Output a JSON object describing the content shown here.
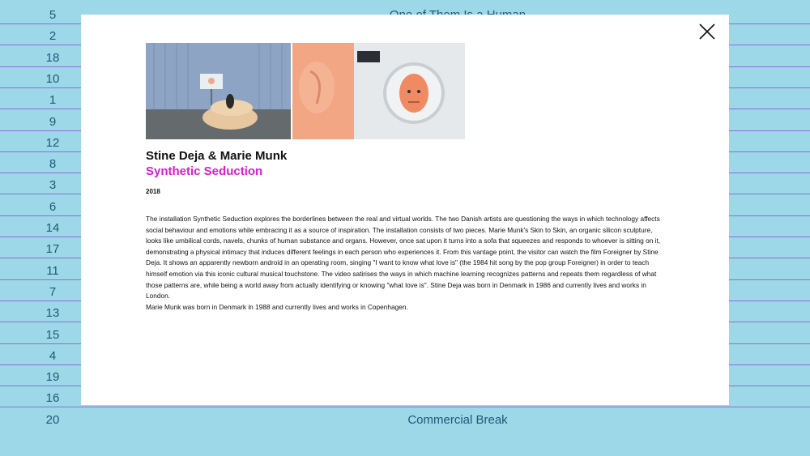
{
  "background_list": {
    "rows": [
      {
        "number": "5",
        "title": "One of Them Is a Human"
      },
      {
        "number": "2",
        "title": ""
      },
      {
        "number": "18",
        "title": ""
      },
      {
        "number": "10",
        "title": ""
      },
      {
        "number": "1",
        "title": ""
      },
      {
        "number": "9",
        "title": ""
      },
      {
        "number": "12",
        "title": ""
      },
      {
        "number": "8",
        "title": ""
      },
      {
        "number": "3",
        "title": ""
      },
      {
        "number": "6",
        "title": ""
      },
      {
        "number": "14",
        "title": ""
      },
      {
        "number": "17",
        "title": ""
      },
      {
        "number": "11",
        "title": ""
      },
      {
        "number": "7",
        "title": ""
      },
      {
        "number": "13",
        "title": ""
      },
      {
        "number": "15",
        "title": ""
      },
      {
        "number": "4",
        "title": ""
      },
      {
        "number": "19",
        "title": ""
      },
      {
        "number": "16",
        "title": ""
      },
      {
        "number": "20",
        "title": "Commercial Break"
      }
    ]
  },
  "modal": {
    "artist": "Stine Deja & Marie Munk",
    "work_title": "Synthetic Seduction",
    "year": "2018",
    "description": [
      "The installation Synthetic Seduction explores the borderlines between the real and virtual worlds. The two Danish artists are questioning the ways in which technology affects social behaviour and emotions while embracing it as a source of inspiration. The installation consists of two pieces. Marie Munk's Skin to Skin, an organic silicon sculpture, looks like umbilical cords, navels, chunks of human substance and organs. However, once sat upon it turns into a sofa that squeezes and responds to whoever is sitting on it, demonstrating a physical intimacy that induces different feelings in each person who experiences it. From this vantage point, the visitor can watch the film Foreigner by Stine Deja. It shows an apparently newborn android in an operating room, singing \"I want to know what love is\" (the 1984 hit song by the pop group Foreigner) in order to teach himself emotion via this iconic cultural musical touchstone. The video satirises the ways in which machine learning recognizes patterns and repeats them regardless of what those patterns are, while being a world away from actually identifying or knowing \"what love is\". Stine Deja was born in Denmark in 1986 and currently lives and works in London.",
      "Marie Munk was born in Denmark in 1988 and currently lives and works in Copenhagen."
    ],
    "close_icon": "close-icon"
  },
  "colors": {
    "page_background": "#9dd8e8",
    "row_divider": "#8a6fd6",
    "list_text": "#1a5a78",
    "title_accent": "#d81bd0",
    "modal_background": "#ffffff"
  }
}
